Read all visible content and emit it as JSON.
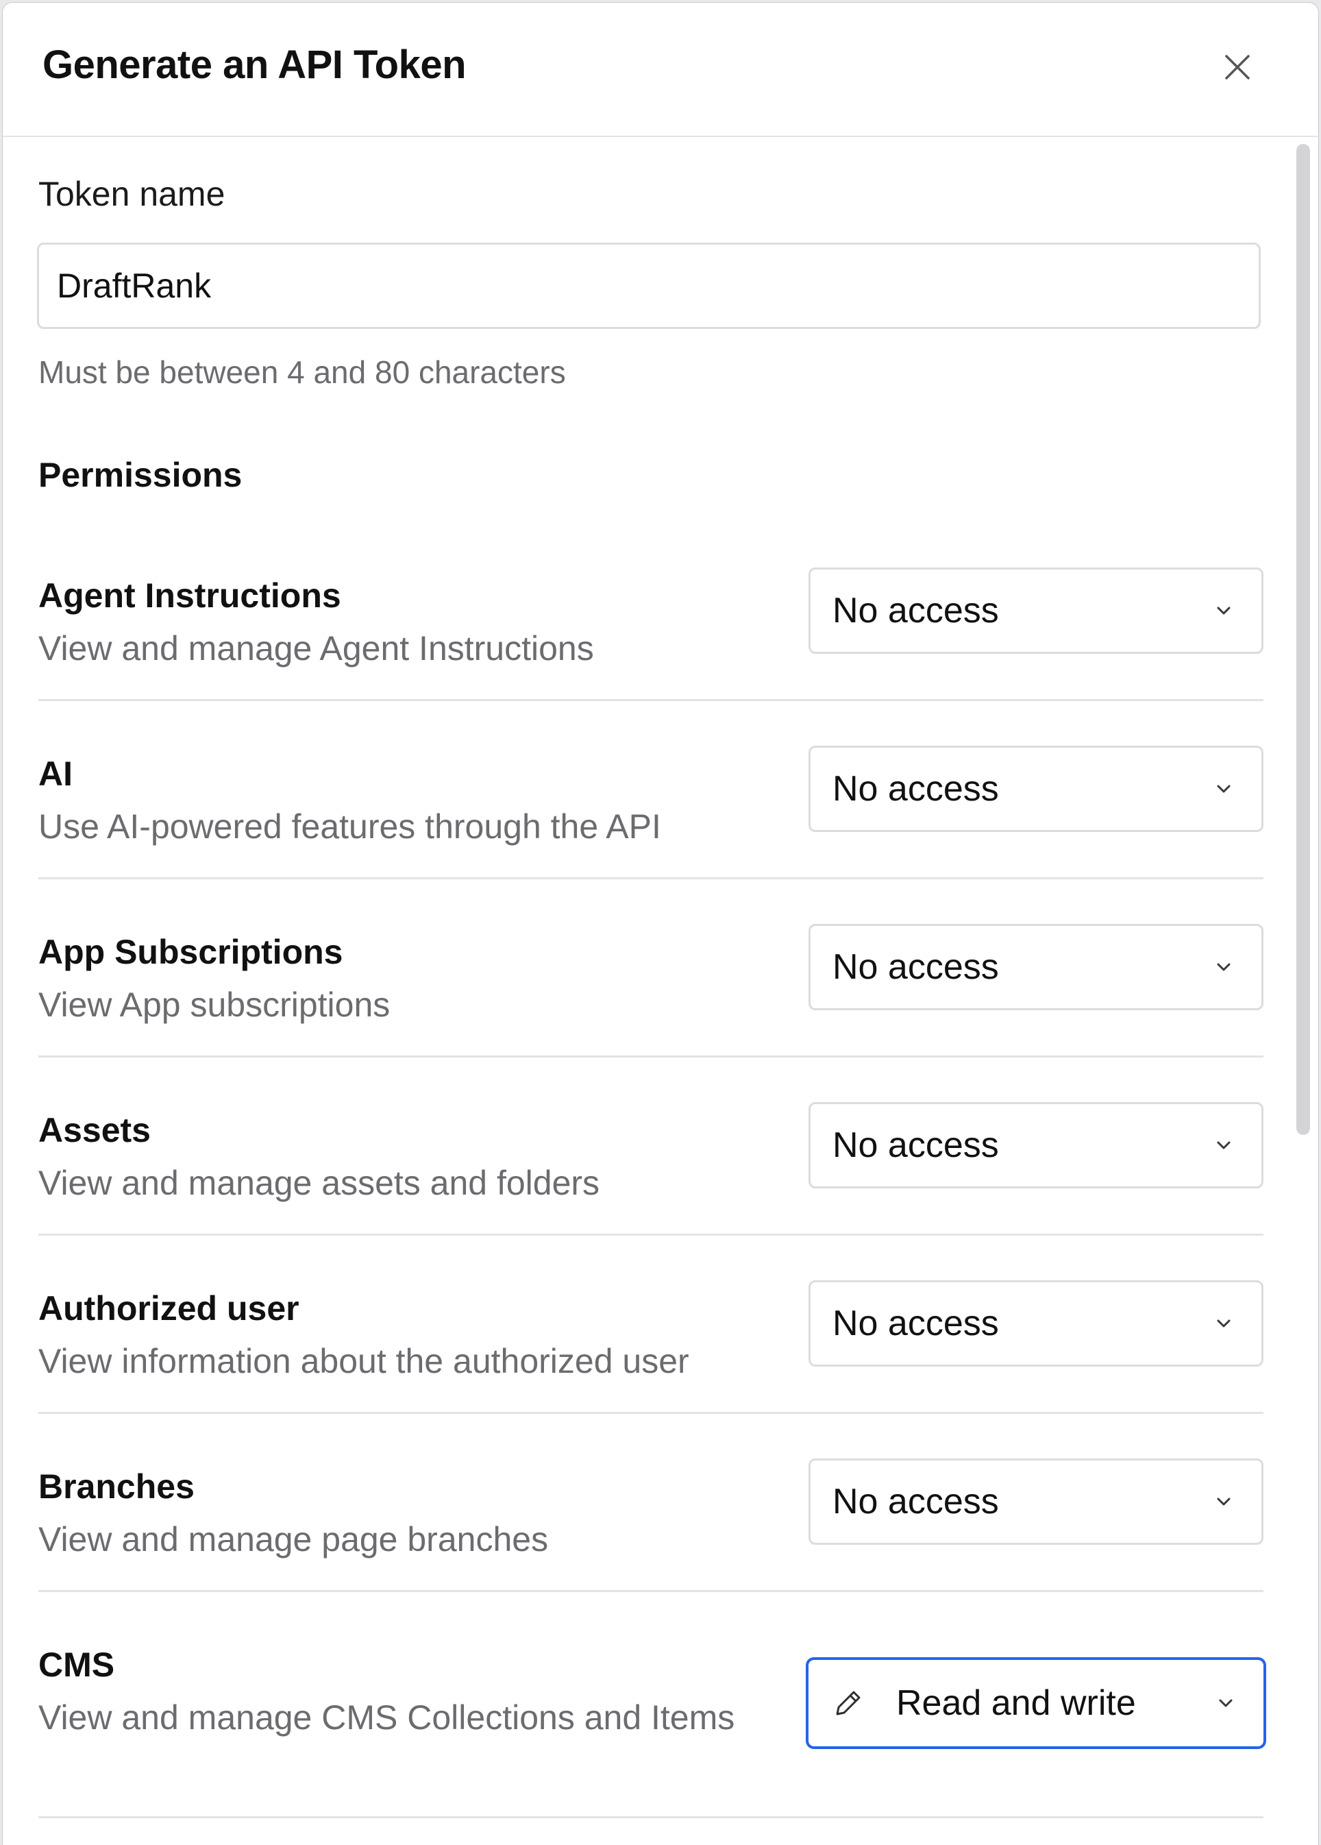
{
  "dialog": {
    "title": "Generate an API Token",
    "close_icon": "close-icon"
  },
  "token": {
    "label": "Token name",
    "value": "DraftRank",
    "hint": "Must be between 4 and 80 characters"
  },
  "permissions": {
    "title": "Permissions",
    "items": [
      {
        "title": "Agent Instructions",
        "description": "View and manage Agent Instructions",
        "access": "No access"
      },
      {
        "title": "AI",
        "description": "Use AI-powered features through the API",
        "access": "No access"
      },
      {
        "title": "App Subscriptions",
        "description": "View App subscriptions",
        "access": "No access"
      },
      {
        "title": "Assets",
        "description": "View and manage assets and folders",
        "access": "No access"
      },
      {
        "title": "Authorized user",
        "description": "View information about the authorized user",
        "access": "No access"
      },
      {
        "title": "Branches",
        "description": "View and manage page branches",
        "access": "No access"
      },
      {
        "title": "CMS",
        "description": "View and manage CMS Collections and Items",
        "access": "Read and write",
        "icon": "pencil-icon"
      }
    ]
  },
  "colors": {
    "accent": "#2563eb",
    "muted_text": "#6b6b70",
    "border": "#dcdce0"
  }
}
